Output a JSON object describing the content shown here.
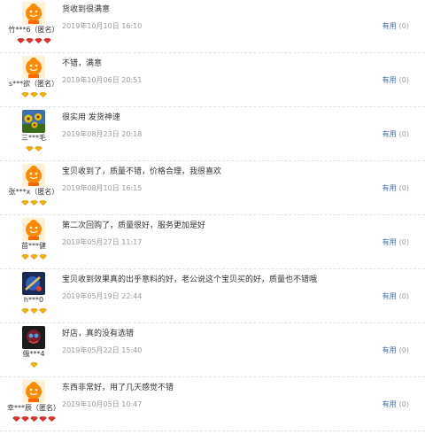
{
  "reviews": [
    {
      "user": "竹***6（匿名）",
      "text": "货收到很满意",
      "date": "2019年10月10日 16:10",
      "useful": "有用",
      "count": "(0)",
      "avatar": "orange",
      "badge": "red",
      "badges": 4
    },
    {
      "user": "s***欲（匿名）",
      "text": "不错，满意",
      "date": "2019年10月06日 20:51",
      "useful": "有用",
      "count": "(0)",
      "avatar": "orange",
      "badge": "gold",
      "badges": 3
    },
    {
      "user": "三***毛",
      "text": "很实用 发货神速",
      "date": "2019年08月23日 20:18",
      "useful": "有用",
      "count": "(0)",
      "avatar": "sunflower",
      "badge": "gold",
      "badges": 2
    },
    {
      "user": "张***x（匿名）",
      "text": "宝贝收到了，质量不错，价格合理，我很喜欢",
      "date": "2019年08月10日 16:15",
      "useful": "有用",
      "count": "(0)",
      "avatar": "orange",
      "badge": "gold",
      "badges": 3
    },
    {
      "user": "苗***健",
      "text": "第二次回购了，质量很好，服务更加是好",
      "date": "2019年05月27日 11:17",
      "useful": "有用",
      "count": "(0)",
      "avatar": "orange",
      "badge": "gold",
      "badges": 3
    },
    {
      "user": "h***0",
      "text": "宝贝收到效果真的出乎意料的好，老公说这个宝贝买的好，质量也不错哦",
      "date": "2019年05月19日 22:44",
      "useful": "有用",
      "count": "(0)",
      "avatar": "blue",
      "badge": "gold",
      "badges": 3
    },
    {
      "user": "俄***4",
      "text": "好店，真的没有选错",
      "date": "2019年05月22日 15:40",
      "useful": "有用",
      "count": "(0)",
      "avatar": "dark",
      "badge": "gold",
      "badges": 1
    },
    {
      "user": "幸***辰（匿名）",
      "text": "东西非常好，用了几天感觉不错",
      "date": "2019年10月05日 10:47",
      "useful": "有用",
      "count": "(0)",
      "avatar": "orange",
      "badge": "red",
      "badges": 5
    }
  ],
  "colors": {
    "link": "#3a6cb5",
    "muted": "#999999",
    "text": "#333333"
  }
}
